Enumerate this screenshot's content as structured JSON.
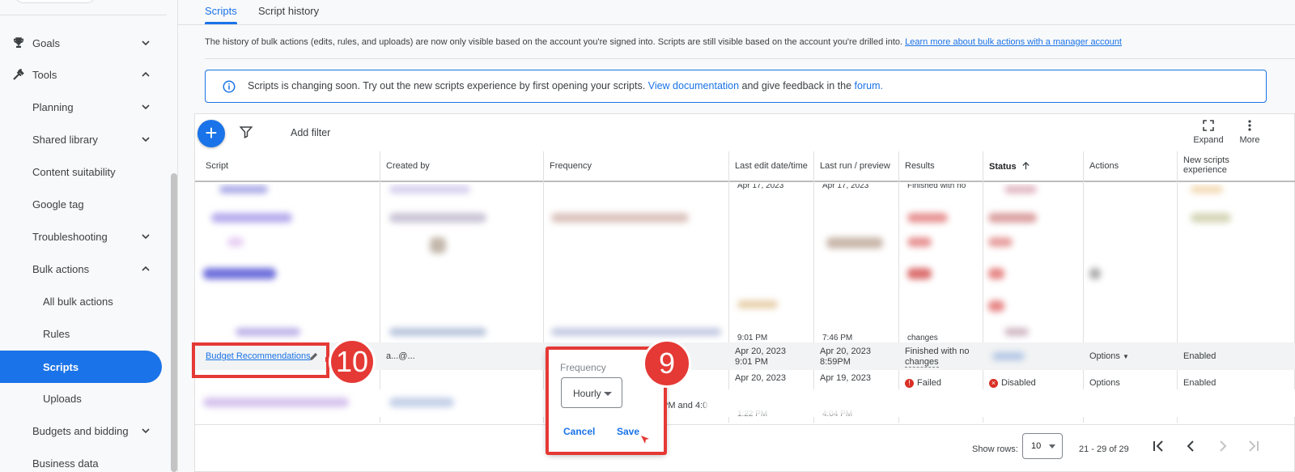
{
  "sidebar": {
    "items": [
      {
        "label": "Goals",
        "icon": "trophy-icon",
        "chevron": "down"
      },
      {
        "label": "Tools",
        "icon": "tools-icon",
        "chevron": "up"
      },
      {
        "label": "Planning",
        "chevron": "down"
      },
      {
        "label": "Shared library",
        "chevron": "down"
      },
      {
        "label": "Content suitability"
      },
      {
        "label": "Google tag"
      },
      {
        "label": "Troubleshooting",
        "chevron": "down"
      },
      {
        "label": "Bulk actions",
        "chevron": "up"
      },
      {
        "label": "All bulk actions"
      },
      {
        "label": "Rules"
      },
      {
        "label": "Scripts",
        "active": true
      },
      {
        "label": "Uploads"
      },
      {
        "label": "Budgets and bidding",
        "chevron": "down"
      },
      {
        "label": "Business data"
      }
    ]
  },
  "tabs": [
    {
      "label": "Scripts",
      "active": true
    },
    {
      "label": "Script history",
      "active": false
    }
  ],
  "notice": {
    "text": "The history of bulk actions (edits, rules, and uploads) are now only visible based on the account you're signed into. Scripts are still visible based on the account you're drilled into.",
    "link": "Learn more about bulk actions with a manager account"
  },
  "banner": {
    "text_1": "Scripts is changing soon. Try out the new scripts experience by first opening your scripts.",
    "link_1": "View documentation",
    "text_2": "and give feedback in the",
    "link_2": "forum."
  },
  "toolbar": {
    "add_label": "+",
    "add_filter": "Add filter",
    "expand_label": "Expand",
    "more_label": "More"
  },
  "table": {
    "columns": [
      "Script",
      "Created by",
      "Frequency",
      "Last edit date/time",
      "Last run / preview",
      "Results",
      "Status",
      "Actions",
      "New scripts experience"
    ],
    "sort_column": "Status",
    "partial_top": {
      "edit": "Apr 17, 2023",
      "run": "Apr 17, 2023",
      "results": "Finished with no"
    },
    "partial_above": {
      "edit": "9:01 PM",
      "run": "7:46 PM",
      "results": "changes"
    },
    "highlight_row": {
      "script": "Budget Recommendations",
      "created_by": "a...@...",
      "edit_date": "Apr 20, 2023",
      "edit_time": "9:01 PM",
      "run_date": "Apr 20, 2023",
      "run_time": "8:59PM",
      "results_1": "Finished with no",
      "results_2": "changes",
      "actions": "Options",
      "new_exp": "Enabled"
    },
    "next_row": {
      "edit_date": "Apr 20, 2023",
      "run_date": "Apr 19, 2023",
      "results": "Failed",
      "status": "Disabled",
      "actions": "Options",
      "new_exp": "Enabled"
    },
    "last_row": {
      "frequency_partial": "PM and 4:0",
      "edit": "1:22 PM",
      "run": "4:04 PM"
    }
  },
  "footer": {
    "show_rows_label": "Show rows:",
    "rows_value": "10",
    "range": "21 - 29 of 29"
  },
  "popup": {
    "label": "Frequency",
    "value": "Hourly",
    "cancel": "Cancel",
    "save": "Save"
  },
  "callouts": {
    "step_a": "10",
    "step_b": "9"
  },
  "colors": {
    "accent": "#1a73e8",
    "callout": "#e53935"
  }
}
